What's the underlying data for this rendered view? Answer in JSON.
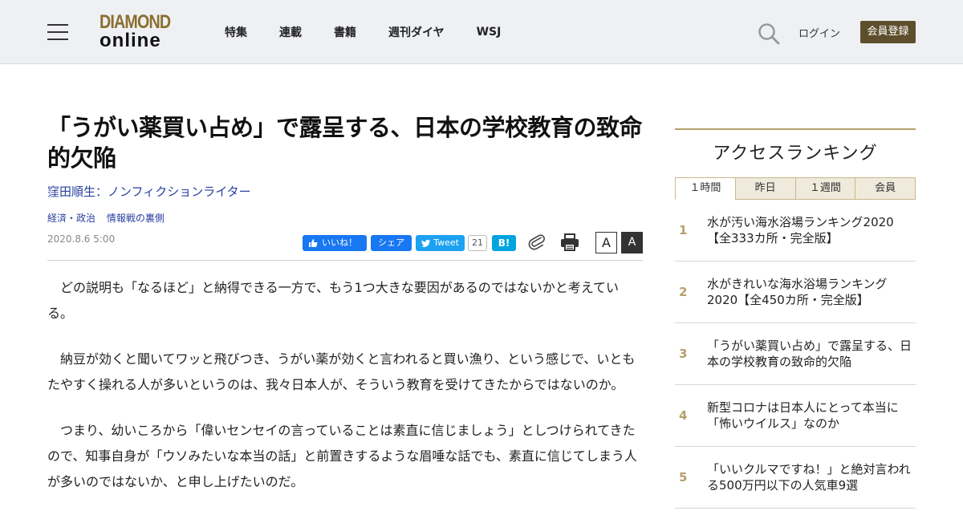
{
  "header": {
    "logo_top": "DIAMOND",
    "logo_bottom": "online",
    "nav": [
      "特集",
      "連載",
      "書籍",
      "週刊ダイヤ",
      "WSJ"
    ],
    "login": "ログイン",
    "register": "会員登録"
  },
  "article": {
    "title": "「うがい薬買い占め」で露呈する、日本の学校教育の致命的欠陥",
    "author": "窪田順生：ノンフィクションライター",
    "categories": [
      "経済・政治",
      "情報戦の裏側"
    ],
    "date": "2020.8.6 5:00",
    "share": {
      "fb_like": "いいね！",
      "fb_share": "シェア",
      "tweet": "Tweet",
      "tweet_count": "21",
      "hatena": "B!"
    },
    "font_small": "A",
    "font_large": "A",
    "paragraphs": [
      "どの説明も「なるほど」と納得できる一方で、もう1つ大きな要因があるのではないかと考えている。",
      "納豆が効くと聞いてワッと飛びつき、うがい薬が効くと言われると買い漁り、という感じで、いともたやすく操れる人が多いというのは、我々日本人が、そういう教育を受けてきたからではないのか。",
      "つまり、幼いころから「偉いセンセイの言っていることは素直に信じましょう」としつけられてきたので、知事自身が「ウソみたいな本当の話」と前置きするような眉唾な話でも、素直に信じてしまう人が多いのではないか、と申し上げたいのだ。"
    ]
  },
  "sidebar": {
    "title": "アクセスランキング",
    "tabs": [
      "１時間",
      "昨日",
      "１週間",
      "会員"
    ],
    "active_tab": "１時間",
    "ranking": [
      {
        "num": "1",
        "text": "水が汚い海水浴場ランキング2020【全333カ所・完全版】"
      },
      {
        "num": "2",
        "text": "水がきれいな海水浴場ランキング2020【全450カ所・完全版】"
      },
      {
        "num": "3",
        "text": "「うがい薬買い占め」で露呈する、日本の学校教育の致命的欠陥"
      },
      {
        "num": "4",
        "text": "新型コロナは日本人にとって本当に「怖いウイルス」なのか"
      },
      {
        "num": "5",
        "text": "「いいクルマですね！」と絶対言われる500万円以下の人気車9選"
      }
    ]
  },
  "colors": {
    "header_bg": "#eef0f3",
    "register_bg": "#5e4f2c",
    "link": "#2a3fa0",
    "accent_gold": "#b5a06a"
  }
}
